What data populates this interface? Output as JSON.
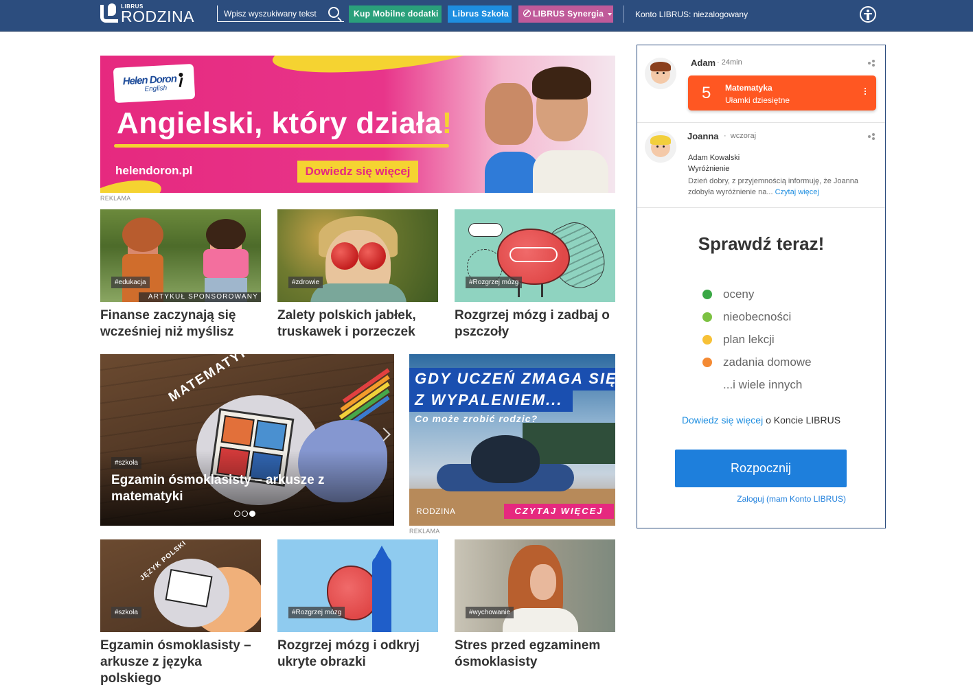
{
  "header": {
    "logo_small": "LIBRUS",
    "logo_big": "RODZINA",
    "search_placeholder": "Wpisz wyszukiwany tekst",
    "btn_mobile": "Kup Mobilne dodatki",
    "btn_szkola": "Librus Szkoła",
    "btn_synergia": "LIBRUS Synergia",
    "account_status": "Konto LIBRUS: niezalogowany",
    "colors": {
      "bar": "#2c4d7e",
      "mobile": "#2aa07b",
      "szkola": "#1e8ee0",
      "synergia": "#c05a9a"
    }
  },
  "banner": {
    "brand": "Helen Doron",
    "brand_sub": "English",
    "headline": "Angielski, który działa",
    "headline_mark": "!",
    "url": "helendoron.pl",
    "cta": "Dowiedz się więcej",
    "ad_label": "REKLAMA"
  },
  "cards_top": [
    {
      "tag": "#edukacja",
      "badge": "ARTYKUŁ SPONSOROWANY",
      "title": "Finanse zaczynają się wcześniej niż myślisz"
    },
    {
      "tag": "#zdrowie",
      "title": "Zalety polskich jabłek, truskawek i porzeczek"
    },
    {
      "tag": "#Rozgrzej mózg",
      "title": "Rozgrzej mózg i zadbaj o pszczoły"
    }
  ],
  "slider": {
    "image_label": "MATEMATYKA",
    "tag": "#szkoła",
    "title": "Egzamin ósmoklasisty – arkusze z matematyki",
    "slide_count": 3,
    "active_slide": 3
  },
  "ad2": {
    "line1": "GDY UCZEŃ ZMAGA SIĘ",
    "line2": "Z WYPALENIEM...",
    "sub": "Co może zrobić rodzic?",
    "logo": "RODZINA",
    "cta": "CZYTAJ WIĘCEJ",
    "ad_label": "REKLAMA"
  },
  "cards_bottom": [
    {
      "tag": "#szkoła",
      "image_label": "JĘZYK POLSKI",
      "title": "Egzamin ósmoklasisty – arkusze z języka polskiego"
    },
    {
      "tag": "#Rozgrzej mózg",
      "title": "Rozgrzej mózg i odkryj ukryte obrazki"
    },
    {
      "tag": "#wychowanie",
      "title": "Stres przed egzaminem ósmoklasisty"
    }
  ],
  "sidebar": {
    "notif1": {
      "name": "Adam",
      "time": "24min",
      "grade": "5",
      "subject": "Matematyka",
      "topic": "Ułamki dziesiętne"
    },
    "notif2": {
      "name": "Joanna",
      "time": "wczoraj",
      "from": "Adam Kowalski",
      "kind": "Wyróżnienie",
      "body": "Dzień dobry, z przyjemnością informuję, że Joanna zdobyła wyróżnienie na...",
      "read_more": "Czytaj więcej"
    },
    "check_title": "Sprawdź teraz!",
    "features": [
      {
        "label": "oceny",
        "color": "#3aa845"
      },
      {
        "label": "nieobecności",
        "color": "#7cc242"
      },
      {
        "label": "plan lekcji",
        "color": "#f7c136"
      },
      {
        "label": "zadania domowe",
        "color": "#f48a33"
      },
      {
        "label": "...i wiele innych",
        "color": ""
      }
    ],
    "more_link": "Dowiedz się więcej",
    "more_suffix": " o Koncie LIBRUS",
    "start_button": "Rozpocznij",
    "login_link": "Zaloguj (mam Konto LIBRUS)"
  }
}
